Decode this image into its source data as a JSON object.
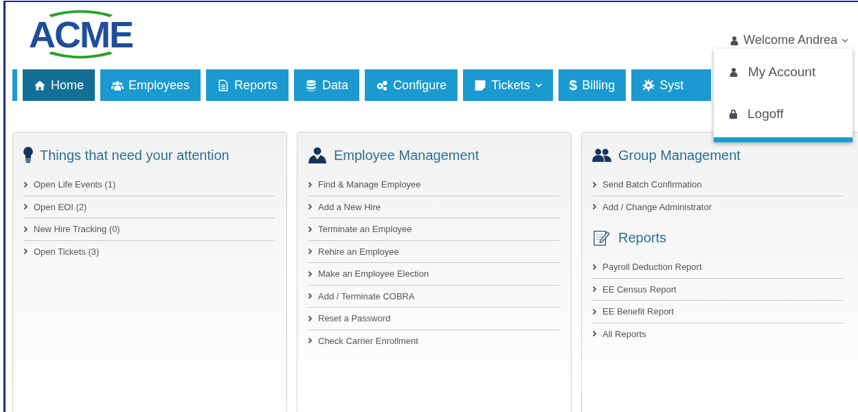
{
  "logo": {
    "text": "ACME"
  },
  "user_menu": {
    "label": "Welcome Andrea",
    "expanded": true,
    "items": [
      {
        "label": "My Account"
      },
      {
        "label": "Logoff"
      }
    ]
  },
  "nav_tabs": [
    {
      "label": "Home",
      "selected": true
    },
    {
      "label": "Employees",
      "selected": false
    },
    {
      "label": "Reports",
      "selected": false
    },
    {
      "label": "Data",
      "selected": false
    },
    {
      "label": "Configure",
      "selected": false
    },
    {
      "label": "Tickets",
      "selected": false,
      "has_menu": true
    },
    {
      "label": "Billing",
      "selected": false,
      "glyph": "$"
    },
    {
      "label": "Syst",
      "selected": false
    }
  ],
  "panels": [
    {
      "sections": [
        {
          "title": "Things that need your attention",
          "links": [
            "Open Life Events (1)",
            "Open EOI (2)",
            "New Hire Tracking (0)",
            "Open Tickets (3)"
          ]
        }
      ]
    },
    {
      "sections": [
        {
          "title": "Employee Management",
          "links": [
            "Find & Manage Employee",
            "Add a New Hire",
            "Terminate an Employee",
            "Rehire an Employee",
            "Make an Employee Election",
            "Add / Terminate COBRA",
            "Reset a Password",
            "Check Carrier Enrollment"
          ]
        }
      ]
    },
    {
      "sections": [
        {
          "title": "Group Management",
          "links": [
            "Send Batch Confirmation",
            "Add / Change Administrator"
          ]
        },
        {
          "title": "Reports",
          "links": [
            "Payroll Deduction Report",
            "EE Census Report",
            "EE Benefit Report",
            "All Reports"
          ]
        }
      ]
    }
  ]
}
